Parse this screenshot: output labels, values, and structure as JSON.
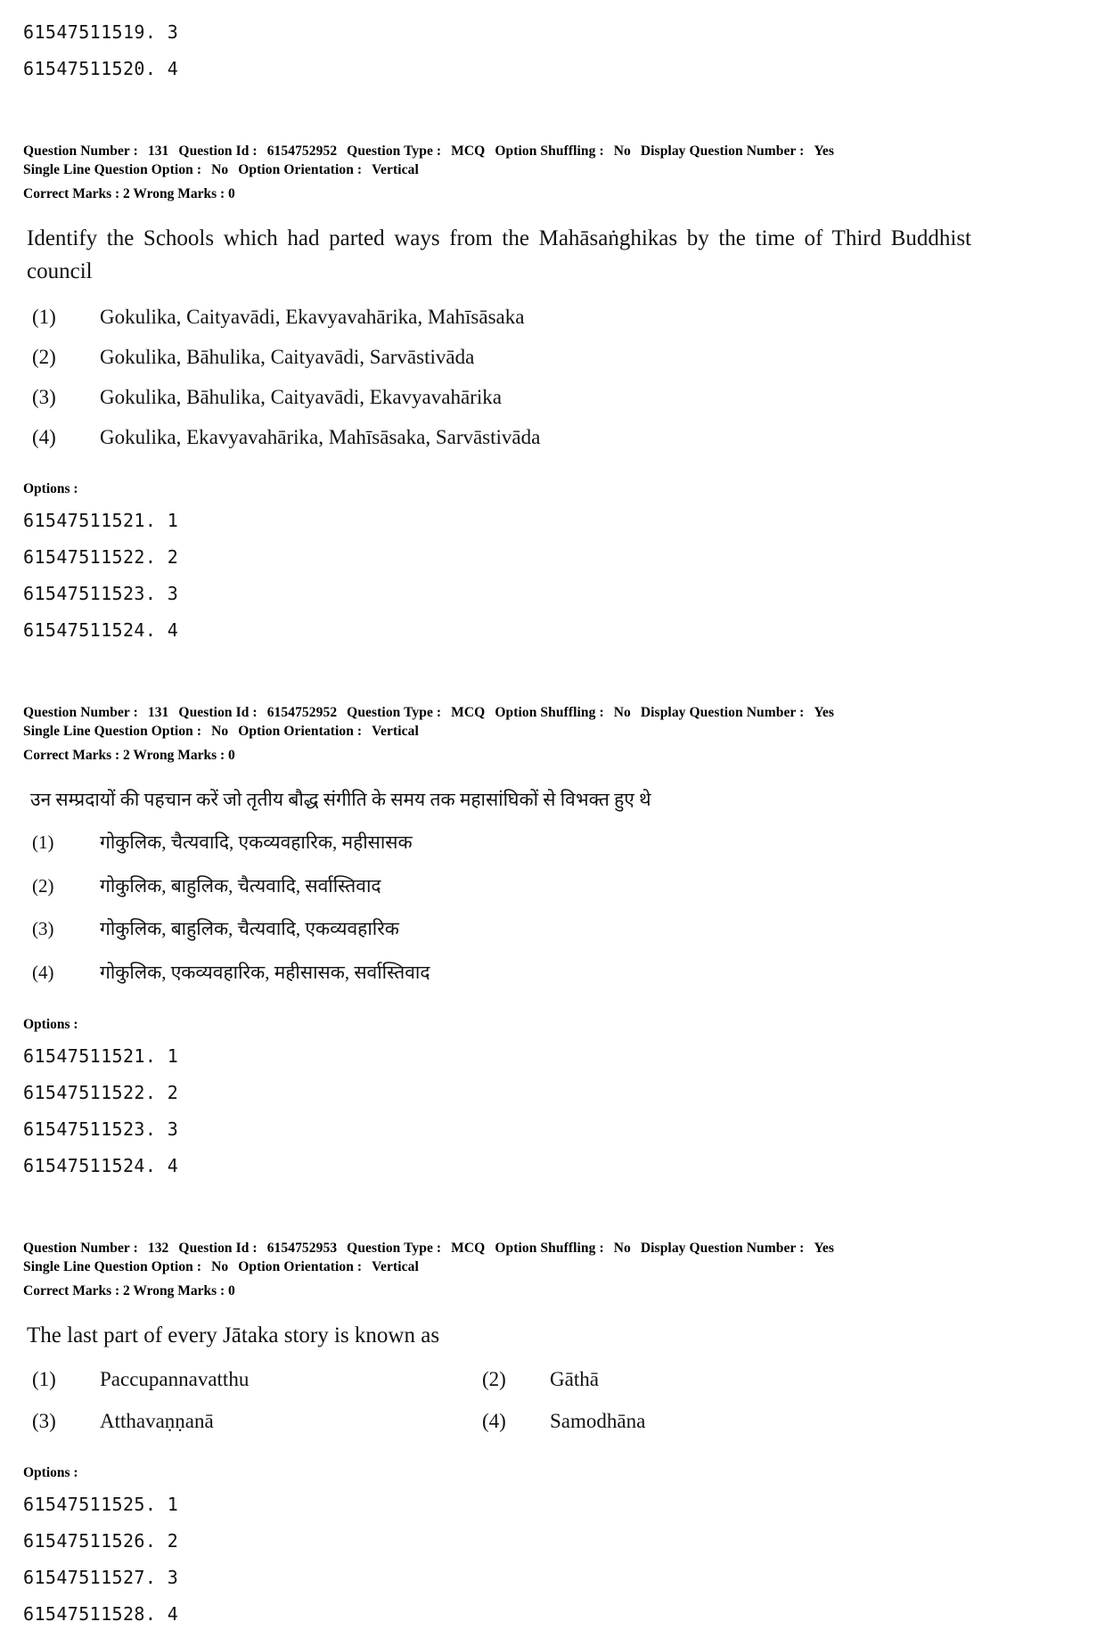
{
  "top_option_codes": [
    "61547511519. 3",
    "61547511520. 4"
  ],
  "questions": [
    {
      "meta": {
        "question_number_label": "Question Number :",
        "question_number": "131",
        "question_id_label": "Question Id :",
        "question_id": "6154752952",
        "question_type_label": "Question Type :",
        "question_type": "MCQ",
        "option_shuffling_label": "Option Shuffling :",
        "option_shuffling": "No",
        "display_question_number_label": "Display Question Number :",
        "display_question_number": "Yes",
        "single_line_question_option_label": "Single Line Question Option :",
        "single_line_question_option": "No",
        "option_orientation_label": "Option Orientation :",
        "option_orientation": "Vertical",
        "correct_marks_label": "Correct Marks :",
        "correct_marks": "2",
        "wrong_marks_label": "Wrong Marks :",
        "wrong_marks": "0"
      },
      "stem": "Identify the Schools which had parted ways from the Mahāsaṅghikas by the time of Third Buddhist council",
      "choices": [
        {
          "num": "(1)",
          "text": "Gokulika, Caityavādi, Ekavyavahārika, Mahīsāsaka"
        },
        {
          "num": "(2)",
          "text": "Gokulika, Bāhulika, Caityavādi, Sarvāstivāda"
        },
        {
          "num": "(3)",
          "text": "Gokulika, Bāhulika, Caityavādi, Ekavyavahārika"
        },
        {
          "num": "(4)",
          "text": "Gokulika, Ekavyavahārika, Mahīsāsaka, Sarvāstivāda"
        }
      ],
      "options_label": "Options :",
      "option_codes": [
        "61547511521. 1",
        "61547511522. 2",
        "61547511523. 3",
        "61547511524. 4"
      ]
    },
    {
      "meta": {
        "question_number_label": "Question Number :",
        "question_number": "131",
        "question_id_label": "Question Id :",
        "question_id": "6154752952",
        "question_type_label": "Question Type :",
        "question_type": "MCQ",
        "option_shuffling_label": "Option Shuffling :",
        "option_shuffling": "No",
        "display_question_number_label": "Display Question Number :",
        "display_question_number": "Yes",
        "single_line_question_option_label": "Single Line Question Option :",
        "single_line_question_option": "No",
        "option_orientation_label": "Option Orientation :",
        "option_orientation": "Vertical",
        "correct_marks_label": "Correct Marks :",
        "correct_marks": "2",
        "wrong_marks_label": "Wrong Marks :",
        "wrong_marks": "0"
      },
      "stem": "उन सम्प्रदायों की पहचान करें जो तृतीय बौद्ध संगीति के समय तक महासांघिकों से विभक्त हुए थे",
      "choices": [
        {
          "num": "(1)",
          "text": "गोकुलिक, चैत्यवादि, एकव्यवहारिक, महीसासक"
        },
        {
          "num": "(2)",
          "text": "गोकुलिक, बाहुलिक, चैत्यवादि, सर्वास्तिवाद"
        },
        {
          "num": "(3)",
          "text": "गोकुलिक, बाहुलिक, चैत्यवादि, एकव्यवहारिक"
        },
        {
          "num": "(4)",
          "text": "गोकुलिक, एकव्यवहारिक, महीसासक, सर्वास्तिवाद"
        }
      ],
      "options_label": "Options :",
      "option_codes": [
        "61547511521. 1",
        "61547511522. 2",
        "61547511523. 3",
        "61547511524. 4"
      ]
    },
    {
      "meta": {
        "question_number_label": "Question Number :",
        "question_number": "132",
        "question_id_label": "Question Id :",
        "question_id": "6154752953",
        "question_type_label": "Question Type :",
        "question_type": "MCQ",
        "option_shuffling_label": "Option Shuffling :",
        "option_shuffling": "No",
        "display_question_number_label": "Display Question Number :",
        "display_question_number": "Yes",
        "single_line_question_option_label": "Single Line Question Option :",
        "single_line_question_option": "No",
        "option_orientation_label": "Option Orientation :",
        "option_orientation": "Vertical",
        "correct_marks_label": "Correct Marks :",
        "correct_marks": "2",
        "wrong_marks_label": "Wrong Marks :",
        "wrong_marks": "0"
      },
      "stem": "The last part of every Jātaka story is known as",
      "choices": [
        {
          "num": "(1)",
          "text": "Paccupannavatthu"
        },
        {
          "num": "(2)",
          "text": "Gāthā"
        },
        {
          "num": "(3)",
          "text": "Atthavaṇṇanā"
        },
        {
          "num": "(4)",
          "text": "Samodhāna"
        }
      ],
      "options_label": "Options :",
      "option_codes": [
        "61547511525. 1",
        "61547511526. 2",
        "61547511527. 3",
        "61547511528. 4"
      ]
    }
  ]
}
